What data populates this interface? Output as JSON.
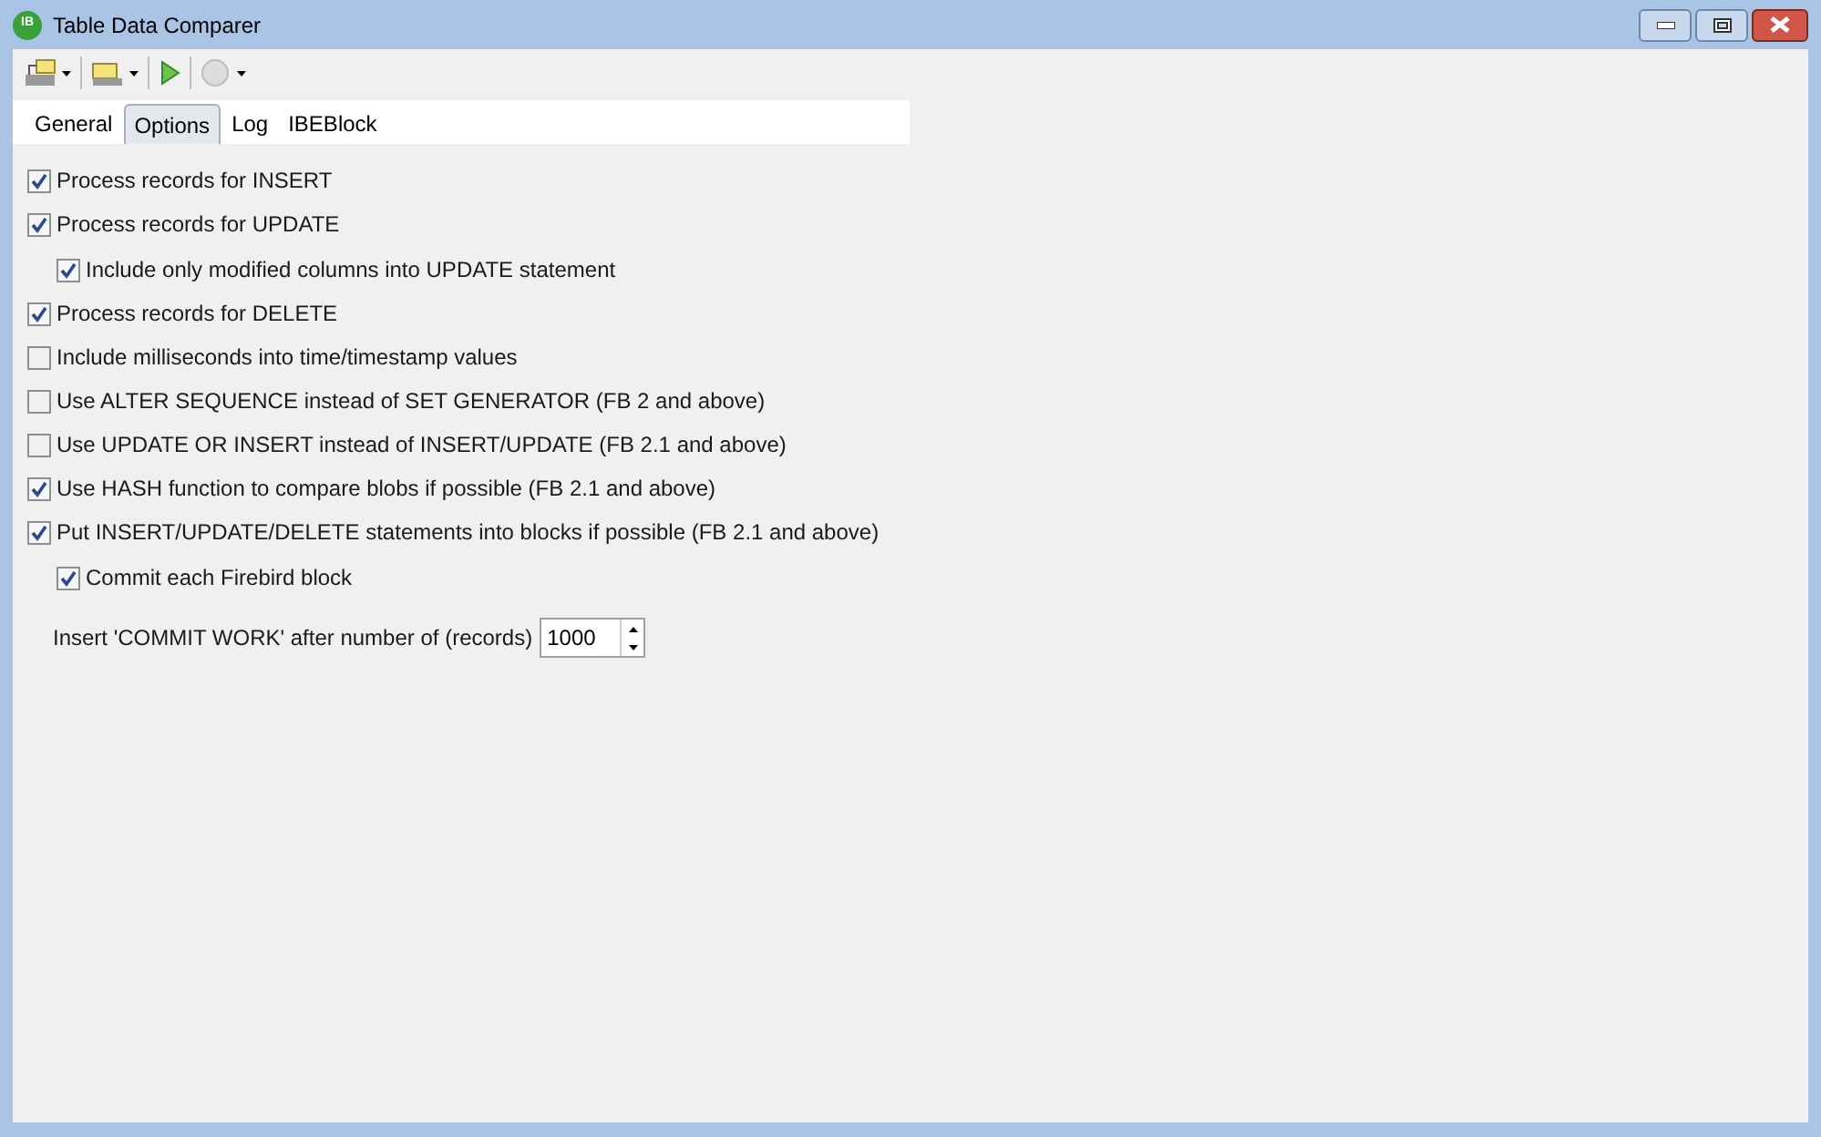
{
  "window": {
    "title": "Table Data Comparer",
    "logo": "IB"
  },
  "tabs": [
    {
      "label": "General",
      "selected": false
    },
    {
      "label": "Options",
      "selected": true
    },
    {
      "label": "Log",
      "selected": false
    },
    {
      "label": "IBEBlock",
      "selected": false
    }
  ],
  "options": [
    {
      "label": "Process records for INSERT",
      "checked": true
    },
    {
      "label": "Process records for UPDATE",
      "checked": true,
      "children": [
        {
          "label": "Include only modified columns into UPDATE statement",
          "checked": true
        }
      ]
    },
    {
      "label": "Process records for DELETE",
      "checked": true
    },
    {
      "label": "Include milliseconds into time/timestamp values",
      "checked": false
    },
    {
      "label": "Use ALTER SEQUENCE instead of SET GENERATOR (FB 2 and above)",
      "checked": false
    },
    {
      "label": "Use UPDATE OR INSERT instead of INSERT/UPDATE (FB 2.1 and above)",
      "checked": false
    },
    {
      "label": "Use HASH function to compare blobs if possible (FB 2.1 and above)",
      "checked": true
    },
    {
      "label": "Put INSERT/UPDATE/DELETE statements into blocks if possible (FB 2.1 and above)",
      "checked": true,
      "children": [
        {
          "label": "Commit each Firebird block",
          "checked": true
        }
      ]
    }
  ],
  "commit_work": {
    "label": "Insert 'COMMIT WORK' after number of (records)",
    "value": "1000"
  }
}
